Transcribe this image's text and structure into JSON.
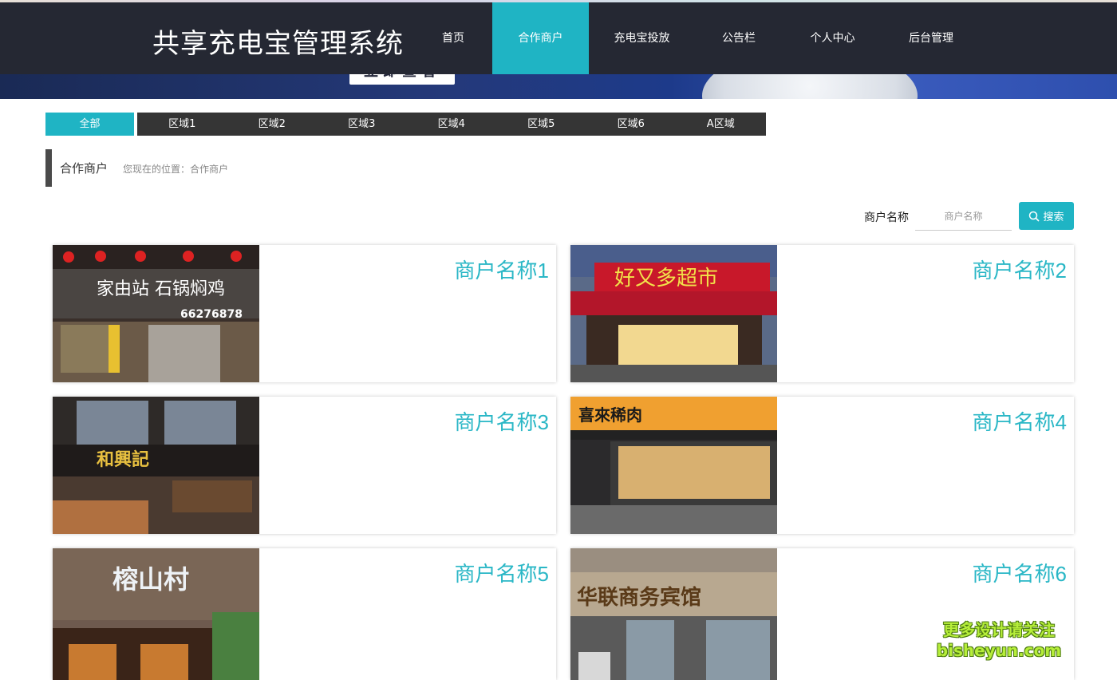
{
  "header": {
    "title": "共享充电宝管理系统",
    "nav": [
      {
        "label": "首页",
        "active": false
      },
      {
        "label": "合作商户",
        "active": true
      },
      {
        "label": "充电宝投放",
        "active": false
      },
      {
        "label": "公告栏",
        "active": false
      },
      {
        "label": "个人中心",
        "active": false
      },
      {
        "label": "后台管理",
        "active": false
      }
    ]
  },
  "banner": {
    "button_label": "立即查看"
  },
  "regions": [
    {
      "label": "全部",
      "active": true
    },
    {
      "label": "区域1",
      "active": false
    },
    {
      "label": "区域2",
      "active": false
    },
    {
      "label": "区域3",
      "active": false
    },
    {
      "label": "区域4",
      "active": false
    },
    {
      "label": "区域5",
      "active": false
    },
    {
      "label": "区域6",
      "active": false
    },
    {
      "label": "A区域",
      "active": false
    }
  ],
  "breadcrumb": {
    "title": "合作商户",
    "path": "您现在的位置：合作商户"
  },
  "search": {
    "label": "商户名称",
    "placeholder": "商户名称",
    "value": "",
    "button_label": "搜索"
  },
  "merchants": [
    {
      "name": "商户名称1",
      "sign": "家由站 石锅焖鸡",
      "phone": "66276878"
    },
    {
      "name": "商户名称2",
      "sign": "好又多超市"
    },
    {
      "name": "商户名称3",
      "sign": "和興記"
    },
    {
      "name": "商户名称4",
      "sign": "喜來稀肉"
    },
    {
      "name": "商户名称5",
      "sign": "榕山村"
    },
    {
      "name": "商户名称6",
      "sign": "华联商务宾馆"
    }
  ],
  "watermark": {
    "line1": "更多设计请关注",
    "line2": "bisheyun.com"
  },
  "colors": {
    "accent": "#1fb4c4",
    "header_bg": "#252833",
    "tab_bg": "#353535",
    "merchant_name": "#2ab7c6"
  }
}
